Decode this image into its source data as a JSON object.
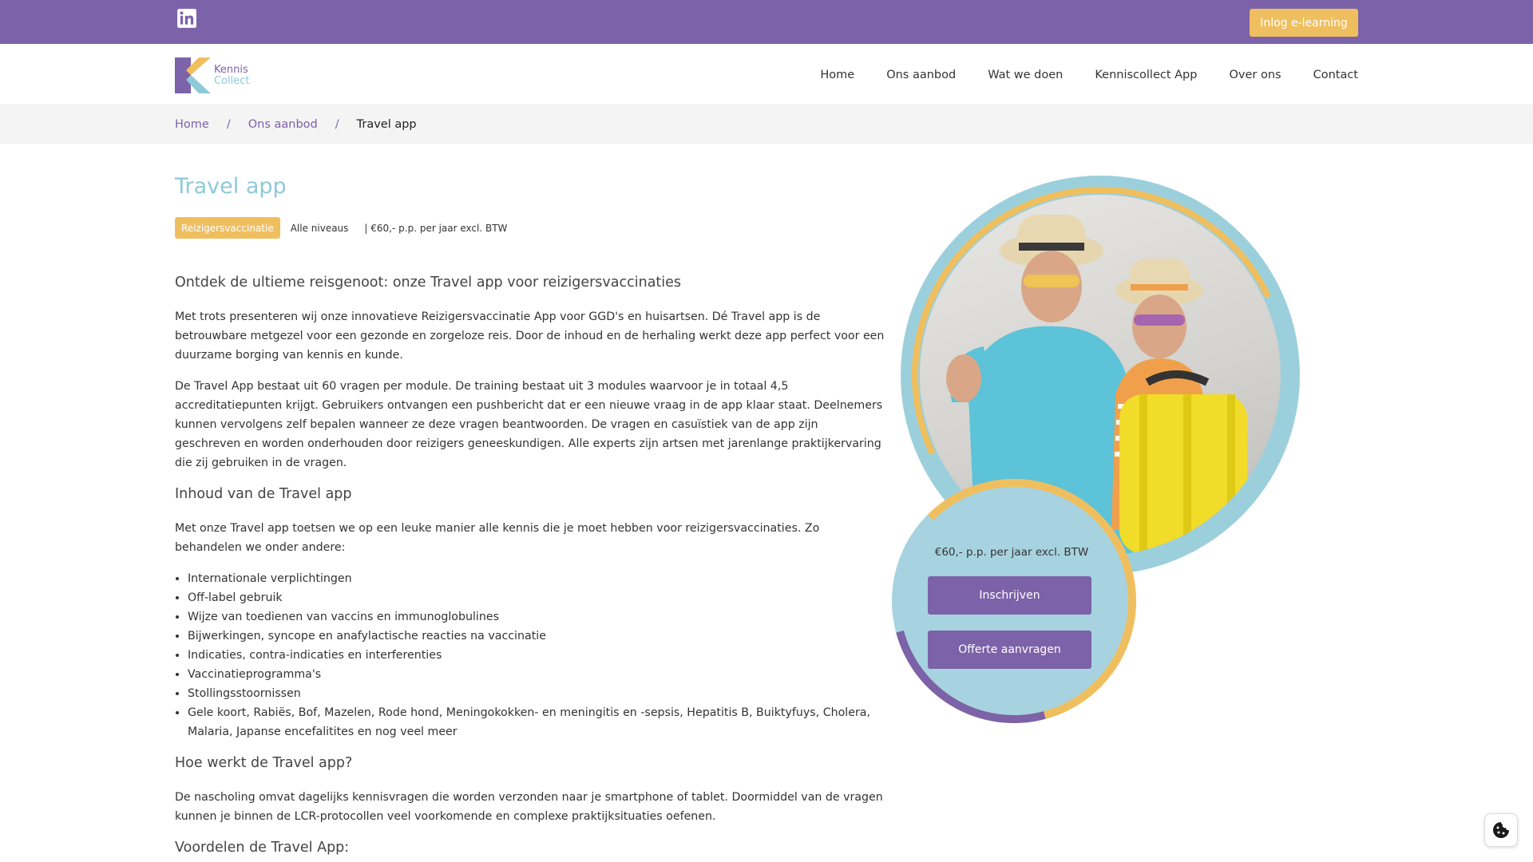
{
  "topbar": {
    "linkedin_icon": "linkedin-icon",
    "login_label": "Inlog e-learning"
  },
  "logo": {
    "line1": "Kennis",
    "line2": "Collect"
  },
  "nav": {
    "items": [
      {
        "label": "Home"
      },
      {
        "label": "Ons aanbod"
      },
      {
        "label": "Wat we doen"
      },
      {
        "label": "Kenniscollect App"
      },
      {
        "label": "Over ons"
      },
      {
        "label": "Contact"
      }
    ]
  },
  "breadcrumb": {
    "items": [
      {
        "label": "Home"
      },
      {
        "label": "Ons aanbod"
      }
    ],
    "separator": "/",
    "current": "Travel app"
  },
  "page": {
    "title": "Travel app",
    "tag": "Reizigersvaccinatie",
    "level": "Alle niveaus",
    "price_meta": "| €60,- p.p. per jaar excl. BTW"
  },
  "content": {
    "h1": "Ontdek de ultieme reisgenoot: onze Travel app voor reizigersvaccinaties",
    "p1": "Met trots presenteren wij onze innovatieve Reizigersvaccinatie App voor GGD's en huisartsen. Dé Travel app is de betrouwbare metgezel voor een gezonde en zorgeloze reis. Door de inhoud en de herhaling werkt deze app perfect voor een duurzame borging van kennis en kunde.",
    "p2": "De Travel App bestaat uit 60 vragen per module. De training bestaat uit 3 modules waarvoor je in totaal 4,5 accreditatiepunten krijgt. Gebruikers ontvangen een pushbericht dat er een nieuwe vraag in de app klaar staat. Deelnemers kunnen vervolgens zelf bepalen wanneer ze deze vragen beantwoorden. De vragen en casuïstiek van de app zijn geschreven en worden onderhouden door reizigers geneeskundigen. Alle experts zijn artsen met jarenlange praktijkervaring die zij gebruiken in de vragen.",
    "h2": "Inhoud van de Travel app",
    "p3": "Met onze Travel app toetsen we op een leuke manier alle kennis die je moet hebben voor reizigersvaccinaties. Zo behandelen we onder andere:",
    "list": [
      "Internationale verplichtingen",
      "Off-label gebruik",
      "Wijze van toedienen van vaccins en immunoglobulines",
      "Bijwerkingen, syncope en anafylactische reacties na vaccinatie",
      "Indicaties, contra-indicaties en interferenties",
      "Vaccinatieprogramma's",
      "Stollingsstoornissen",
      "Gele koort, Rabiës, Bof, Mazelen, Rode hond, Meningokokken- en meningitis en -sepsis, Hepatitis B, Buiktyfuys, Cholera, Malaria, Japanse encefalitites en nog veel meer"
    ],
    "h3": "Hoe werkt de Travel app?",
    "p4": "De nascholing omvat dagelijks kennisvragen die worden verzonden naar je smartphone of tablet. Doormiddel van de vragen kunnen je binnen de LCR-protocollen veel voorkomende en complexe praktijksituaties oefenen.",
    "h4": "Voordelen de Travel App:"
  },
  "card": {
    "price": "€60,- p.p. per jaar excl. BTW",
    "enroll_label": "Inschrijven",
    "quote_label": "Offerte aanvragen"
  },
  "colors": {
    "purple": "#7c62a8",
    "yellow": "#efbf5f",
    "light_blue": "#8ec9d8"
  },
  "cookie_icon": "cookie-icon"
}
